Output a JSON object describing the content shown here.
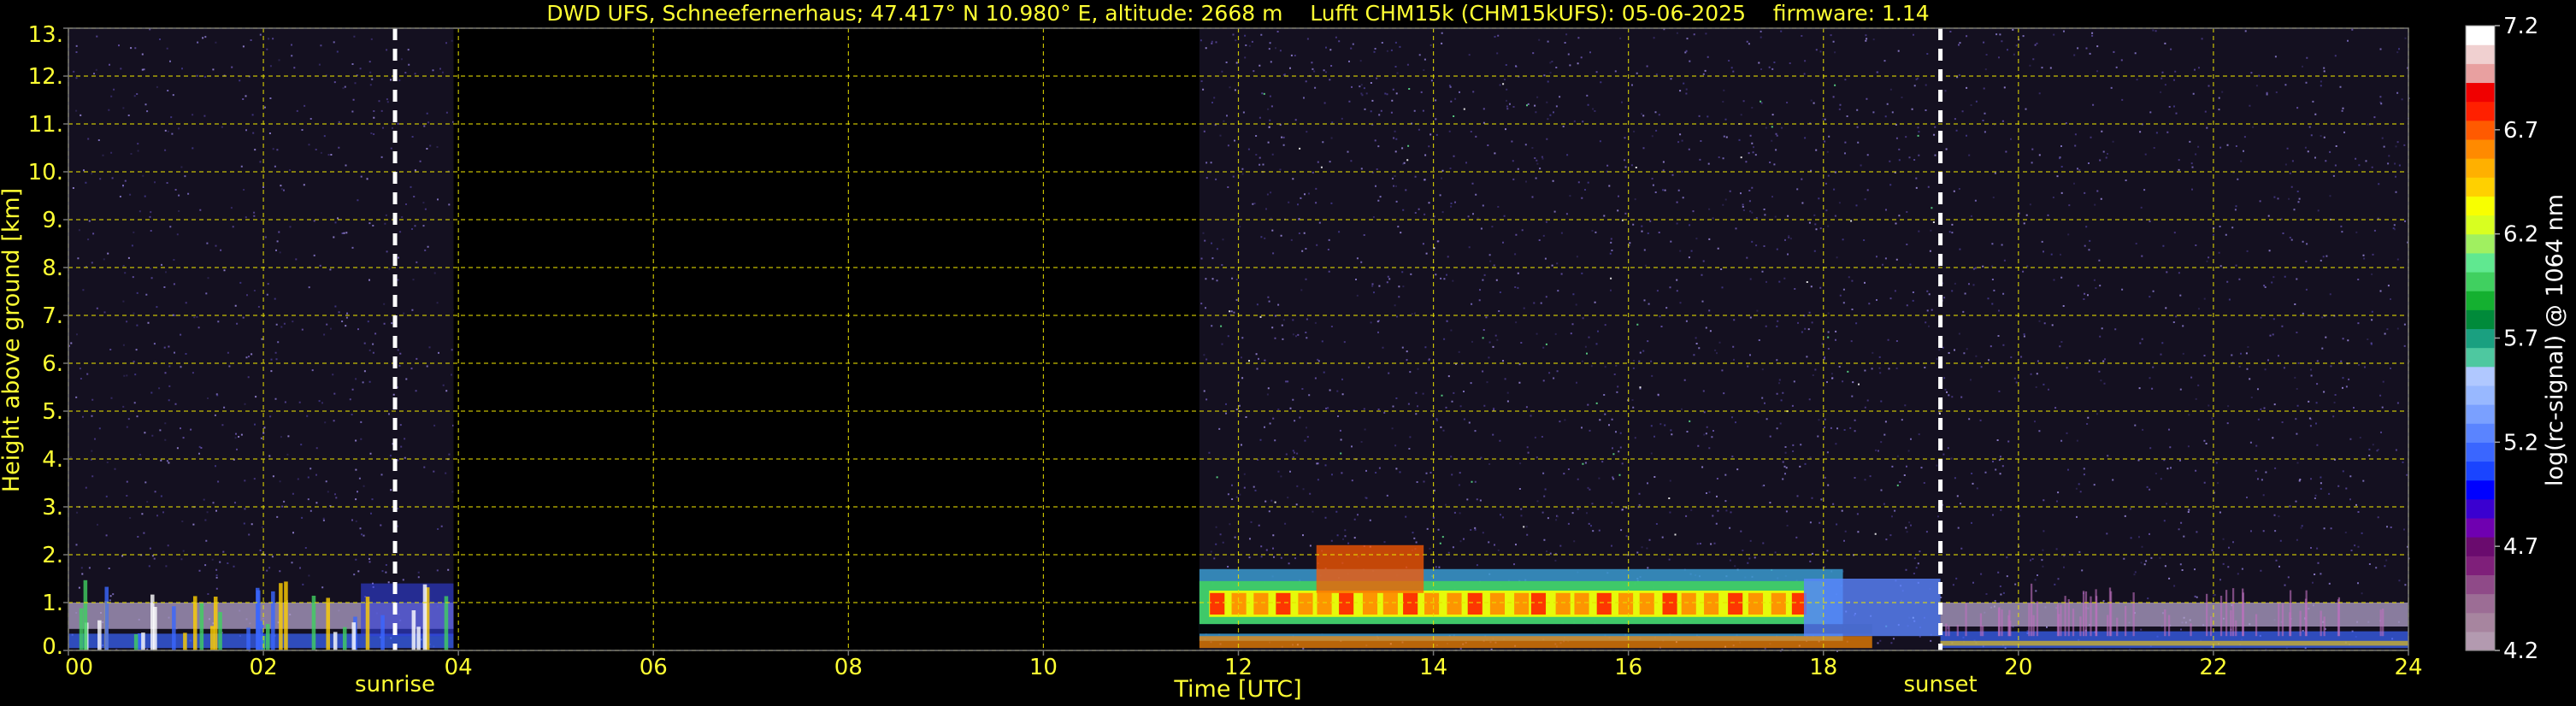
{
  "chart_data": {
    "type": "heatmap",
    "title": "DWD UFS, Schneefernerhaus; 47.417° N 10.980° E, altitude: 2668 m    Lufft CHM15k (CHM15kUFS): 05-06-2025    firmware: 1.14",
    "xlabel": "Time [UTC]",
    "ylabel": "Height above ground [km]",
    "xlim": [
      0,
      24
    ],
    "ylim": [
      0,
      13
    ],
    "x_ticks": [
      "00",
      "02",
      "04",
      "06",
      "08",
      "10",
      "12",
      "14",
      "16",
      "18",
      "20",
      "22",
      "24"
    ],
    "y_ticks": [
      "0.",
      "1.",
      "2.",
      "3.",
      "4.",
      "5.",
      "6.",
      "7.",
      "8.",
      "9.",
      "10.",
      "11.",
      "12.",
      "13."
    ],
    "grid": true,
    "colorbar": {
      "label": "log(rc-signal) @ 1064 nm",
      "min": 4.2,
      "max": 7.2,
      "ticks": [
        "4.2",
        "4.7",
        "5.2",
        "5.7",
        "6.2",
        "6.7",
        "7.2"
      ],
      "colors": [
        "#b39ab0",
        "#a7859f",
        "#9c6d95",
        "#8f4a88",
        "#7f1f7a",
        "#6a0b6e",
        "#6f00b0",
        "#3a00d0",
        "#0000ff",
        "#1a44ff",
        "#3a66ff",
        "#5a84ff",
        "#7aa0ff",
        "#98b8ff",
        "#b0c8ff",
        "#4ec8a0",
        "#1aa080",
        "#008a3a",
        "#14b030",
        "#40d060",
        "#60e890",
        "#a0f060",
        "#d8ff20",
        "#f8ff00",
        "#ffd000",
        "#ffb000",
        "#ff8a00",
        "#ff5a00",
        "#ff2000",
        "#f00000",
        "#e8a0a0",
        "#f0d0d0",
        "#ffffff"
      ]
    },
    "annotations": [
      {
        "label": "sunrise",
        "x": 3.35
      },
      {
        "label": "sunset",
        "x": 19.2
      }
    ],
    "no_data_gaps": [
      [
        3.95,
        11.6
      ]
    ],
    "cloud_layer_km": [
      0.2,
      1.7
    ]
  }
}
